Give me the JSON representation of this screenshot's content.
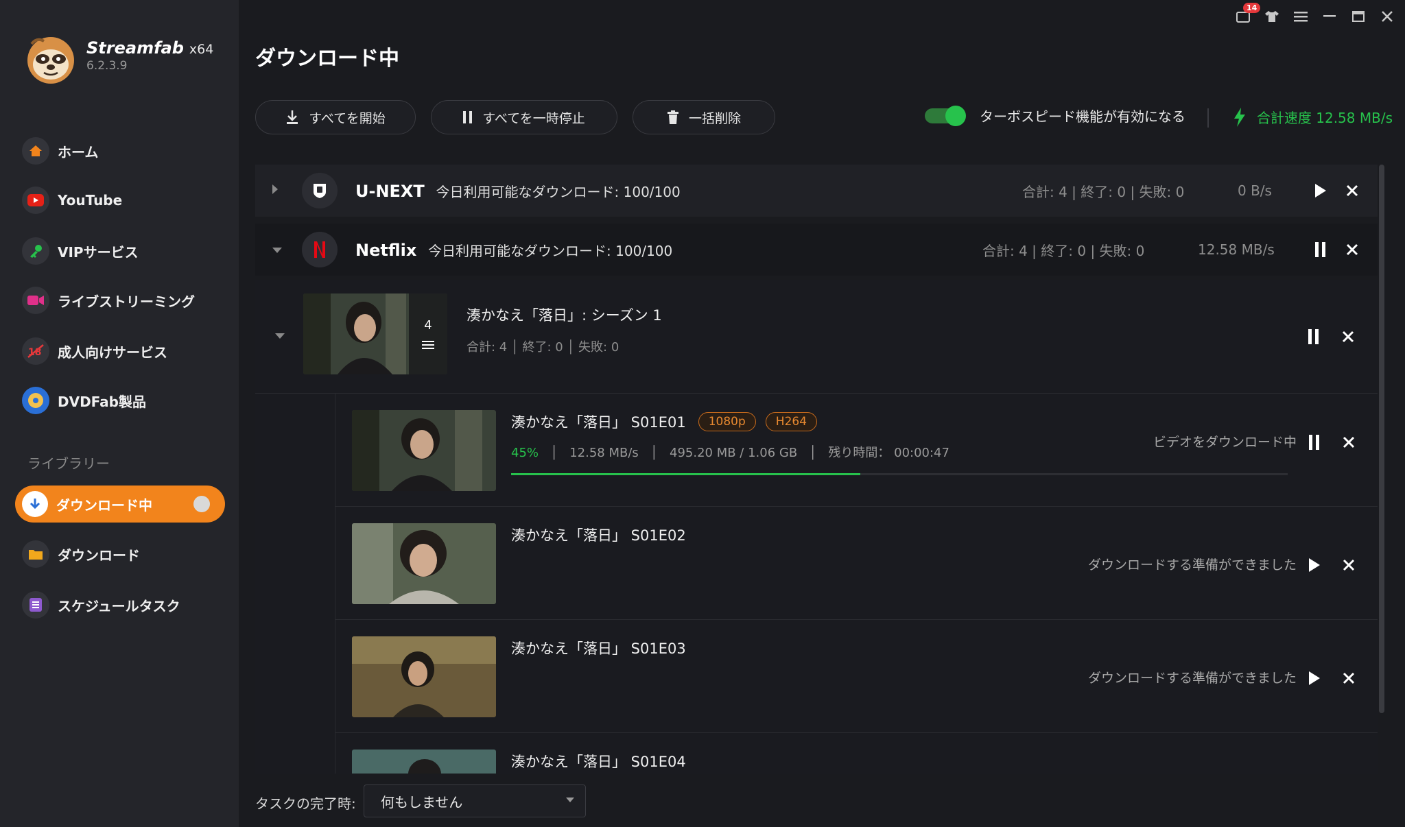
{
  "app": {
    "name": "Streamfab",
    "arch": "x64",
    "version": "6.2.3.9",
    "notification_count": "14"
  },
  "sidebar": {
    "items": [
      {
        "label": "ホーム"
      },
      {
        "label": "YouTube"
      },
      {
        "label": "VIPサービス"
      },
      {
        "label": "ライブストリーミング"
      },
      {
        "label": "成人向けサービス"
      },
      {
        "label": "DVDFab製品"
      }
    ],
    "library_label": "ライブラリー",
    "library_items": [
      {
        "label": "ダウンロード中",
        "active": true
      },
      {
        "label": "ダウンロード"
      },
      {
        "label": "スケジュールタスク"
      }
    ]
  },
  "header": {
    "title": "ダウンロード中"
  },
  "toolbar": {
    "start_all": "すべてを開始",
    "pause_all": "すべてを一時停止",
    "delete_all": "一括削除",
    "turbo_label": "ターボスピード機能が有効になる",
    "turbo_enabled": true,
    "total_speed": "合計速度 12.58 MB/s"
  },
  "services": [
    {
      "name": "U-NEXT",
      "quota": "今日利用可能なダウンロード: 100/100",
      "stats": "合計: 4 | 終了: 0 | 失敗: 0",
      "speed": "0 B/s"
    },
    {
      "name": "Netflix",
      "quota": "今日利用可能なダウンロード: 100/100",
      "stats": "合計: 4 | 終了: 0 | 失敗: 0",
      "speed": "12.58 MB/s"
    }
  ],
  "season": {
    "title": "湊かなえ「落日」: シーズン 1",
    "stats": "合計: 4 │ 終了: 0 │ 失敗: 0",
    "episode_count": "4"
  },
  "episodes": [
    {
      "title": "湊かなえ「落日」 S01E01",
      "resolution": "1080p",
      "codec": "H264",
      "percent": "45%",
      "speed": "12.58 MB/s",
      "size": "495.20 MB / 1.06 GB",
      "remaining": "残り時間： 00:00:47",
      "progress": 0.45,
      "status": "ビデオをダウンロード中"
    },
    {
      "title": "湊かなえ「落日」 S01E02",
      "status": "ダウンロードする準備ができました"
    },
    {
      "title": "湊かなえ「落日」 S01E03",
      "status": "ダウンロードする準備ができました"
    },
    {
      "title": "湊かなえ「落日」 S01E04",
      "status": ""
    }
  ],
  "footer": {
    "label": "タスクの完了時:",
    "select_value": "何もしません"
  },
  "colors": {
    "accent": "#f2841c",
    "success": "#27c24c",
    "netflix": "#e50914"
  }
}
